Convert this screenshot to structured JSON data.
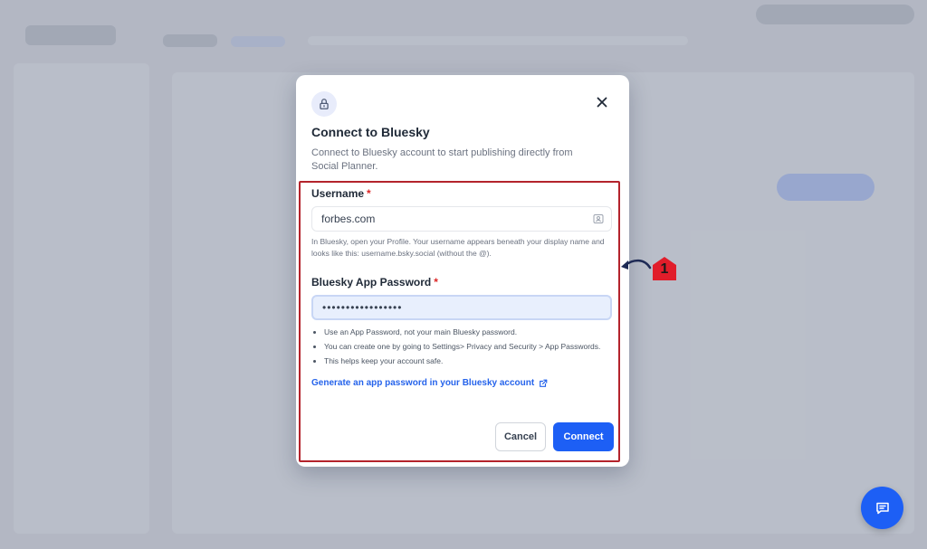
{
  "modal": {
    "title": "Connect to Bluesky",
    "subtitle": "Connect to Bluesky account to start publishing directly from Social Planner.",
    "username": {
      "label": "Username",
      "required_mark": "*",
      "value": "forbes.com",
      "help": "In Bluesky, open your Profile. Your username appears beneath your display name and looks like this: username.bsky.social (without the @)."
    },
    "password": {
      "label": "Bluesky App Password",
      "required_mark": "*",
      "value": "•••••••••••••••••",
      "tips": [
        "Use an App Password, not your main Bluesky password.",
        "You can create one by going to Settings> Privacy and Security > App Passwords.",
        "This helps keep your account safe."
      ]
    },
    "generate_link": "Generate an app password in your Bluesky account",
    "cancel_label": "Cancel",
    "connect_label": "Connect"
  },
  "annotation": {
    "step_number": "1",
    "highlight_color": "#b4232c"
  },
  "colors": {
    "primary": "#1d5ff5",
    "required": "#dc2626",
    "link": "#2563eb"
  },
  "icons": {
    "modal": "lock-icon",
    "close": "close-icon",
    "username_field": "contact-card-icon",
    "link": "external-link-icon",
    "chat": "chat-icon"
  }
}
